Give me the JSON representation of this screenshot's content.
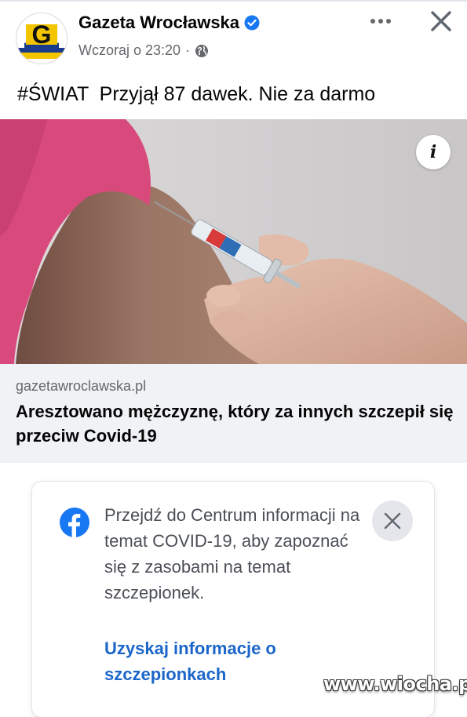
{
  "header": {
    "page_name": "Gazeta Wrocławska",
    "timestamp": "Wczoraj o 23:20",
    "separator": "·",
    "avatar_letter": "G",
    "icons": {
      "verified": "verified-badge-icon",
      "audience": "globe-icon",
      "more": "more-options-icon",
      "close": "close-icon"
    }
  },
  "post": {
    "text": "#ŚWIAT  Przyjął 87 dawek. Nie za darmo"
  },
  "link_preview": {
    "info_label": "i",
    "domain": "gazetawroclawska.pl",
    "title": "Aresztowano mężczyznę, który za innych szczepił się przeciw Covid-19"
  },
  "covid_card": {
    "icon": "facebook-logo-icon",
    "message": "Przejdź do Centrum informacji na temat COVID-19, aby zapoznać się z zasobami na temat szczepionek.",
    "link": "Uzyskaj informacje o szczepionkach",
    "close_icon": "close-icon"
  },
  "watermark": "www.wiocha.pl",
  "colors": {
    "fb_blue": "#1877f2",
    "link_blue": "#1b66c9",
    "secondary_text": "#65676b",
    "link_box_bg": "#f0f2f5",
    "shirt_pink": "#d94a7c"
  }
}
